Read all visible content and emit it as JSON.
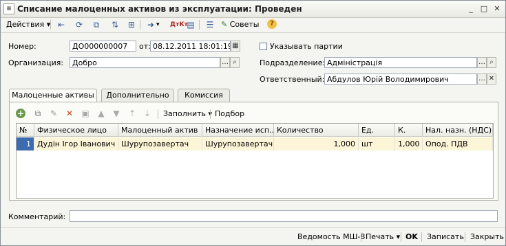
{
  "window": {
    "title": "Списание малоценных активов из эксплуатации: Проведен",
    "icon": "document-icon",
    "buttons": [
      "_",
      "□",
      "✕"
    ]
  },
  "toolbar": {
    "actions_label": "Действия",
    "advice_label": "Советы",
    "help_label": "?"
  },
  "header": {
    "number_label": "Номер:",
    "number_value": "ДО000000007",
    "date_label": "от:",
    "date_value": "08.12.2011 18:01:19",
    "org_label": "Организация:",
    "org_value": "Добро",
    "batch_checkbox_label": "Указывать партии",
    "batch_checked": false,
    "dept_label": "Подразделение:",
    "dept_value": "Адміністрація",
    "resp_label": "Ответственный:",
    "resp_value": "Абдулов Юрій Володимирович"
  },
  "tabs": [
    {
      "label": "Малоценные активы",
      "active": true
    },
    {
      "label": "Дополнительно",
      "active": false
    },
    {
      "label": "Комиссия",
      "active": false
    }
  ],
  "table_toolbar": {
    "fill_label": "Заполнить",
    "select_label": "Подбор"
  },
  "table": {
    "columns": [
      "№",
      "Физическое лицо",
      "Малоценный актив",
      "Назначение исп...",
      "Количество",
      "Ед.",
      "К.",
      "Нал. назн. (НДС)"
    ],
    "rows": [
      [
        "1",
        "Дудін Ігор Іванович",
        "Шурупозавертач",
        "Шурупозавертач",
        "1,000",
        "шт",
        "1,000",
        "Опод. ПДВ"
      ]
    ]
  },
  "comment": {
    "label": "Комментарий:",
    "value": ""
  },
  "footer": {
    "ms8_label": "Ведомость МШ-8",
    "print_label": "Печать",
    "ok_label": "OK",
    "save_label": "Записать",
    "close_label": "Закрыть"
  },
  "colors": {
    "selected_row": "#fdf5d8",
    "window_bg": "#f4f4f0",
    "accent_icon": "#3a5fa0"
  }
}
